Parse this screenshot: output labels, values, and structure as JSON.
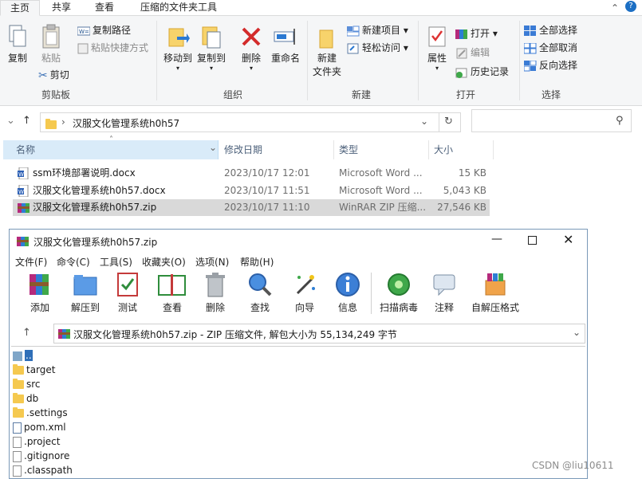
{
  "ribbon_tabs": [
    "主页",
    "共享",
    "查看",
    "压缩的文件夹工具"
  ],
  "ribbon": {
    "clipboard": {
      "copy": "复制",
      "paste": "粘贴",
      "copy_path": "复制路径",
      "paste_shortcut": "粘贴快捷方式",
      "cut": "剪切",
      "label": "剪贴板"
    },
    "organize": {
      "move_to": "移动到",
      "copy_to": "复制到",
      "delete": "删除",
      "rename": "重命名",
      "label": "组织"
    },
    "new": {
      "new_folder_l1": "新建",
      "new_folder_l2": "文件夹",
      "new_item": "新建项目",
      "easy_access": "轻松访问",
      "label": "新建"
    },
    "open": {
      "properties": "属性",
      "open": "打开",
      "edit": "编辑",
      "history": "历史记录",
      "label": "打开"
    },
    "select": {
      "select_all": "全部选择",
      "select_none": "全部取消",
      "invert": "反向选择",
      "label": "选择"
    }
  },
  "address": {
    "path": "汉服文化管理系统h0h57"
  },
  "columns": [
    "名称",
    "修改日期",
    "类型",
    "大小"
  ],
  "files": [
    {
      "name": "ssm环境部署说明.docx",
      "date": "2023/10/17 12:01",
      "type": "Microsoft Word ...",
      "size": "15 KB"
    },
    {
      "name": "汉服文化管理系统h0h57.docx",
      "date": "2023/10/17 11:51",
      "type": "Microsoft Word ...",
      "size": "5,043 KB"
    },
    {
      "name": "汉服文化管理系统h0h57.zip",
      "date": "2023/10/17 11:10",
      "type": "WinRAR ZIP 压缩...",
      "size": "27,546 KB"
    }
  ],
  "rar": {
    "title": "汉服文化管理系统h0h57.zip",
    "menus": [
      "文件(F)",
      "命令(C)",
      "工具(S)",
      "收藏夹(O)",
      "选项(N)",
      "帮助(H)"
    ],
    "tools": [
      "添加",
      "解压到",
      "测试",
      "查看",
      "删除",
      "查找",
      "向导",
      "信息",
      "扫描病毒",
      "注释",
      "自解压格式"
    ],
    "path": "汉服文化管理系统h0h57.zip - ZIP 压缩文件, 解包大小为 55,134,249 字节",
    "entries": [
      "..",
      "target",
      "src",
      "db",
      ".settings",
      "pom.xml",
      ".project",
      ".gitignore",
      ".classpath"
    ]
  },
  "watermark": "CSDN @liu10611"
}
